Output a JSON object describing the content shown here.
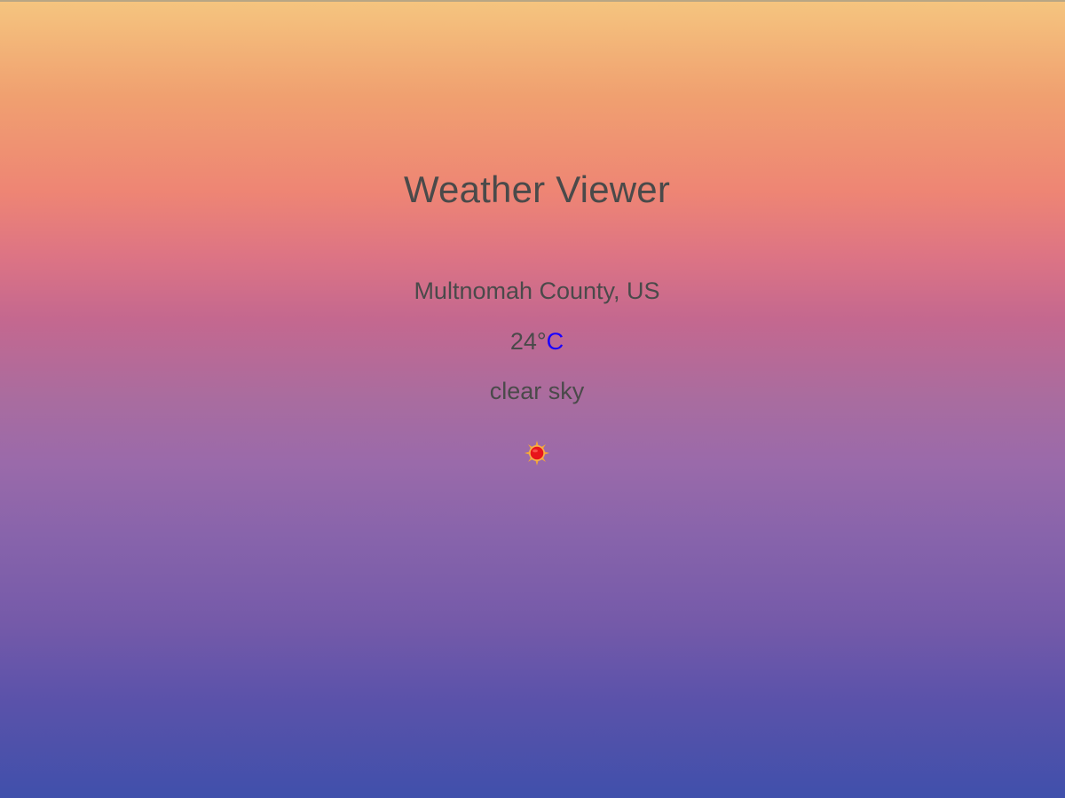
{
  "app": {
    "title": "Weather Viewer"
  },
  "weather": {
    "location": "Multnomah County, US",
    "temperature_value": "24°",
    "temperature_unit": "C",
    "description": "clear sky",
    "icon": "sun-icon"
  },
  "colors": {
    "text": "#4a4a4a",
    "unit_link": "#1a00ff",
    "gradient_top": "#f5c57f",
    "gradient_bottom": "#4050ab",
    "sun_core": "#e8161b",
    "sun_rays": "#f3a536"
  }
}
